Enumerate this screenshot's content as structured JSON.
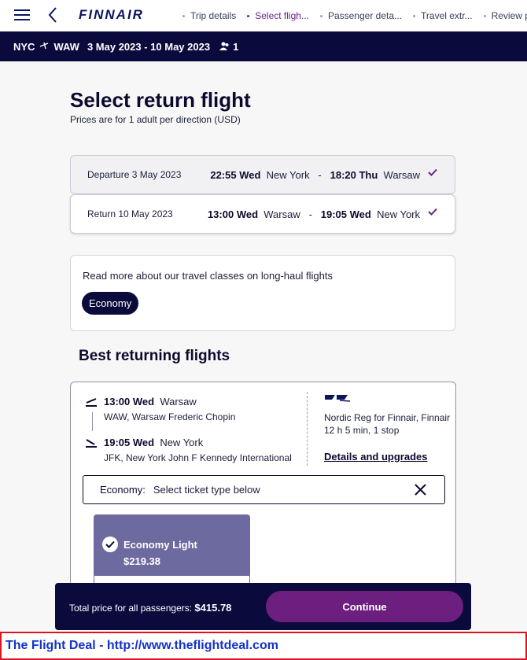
{
  "nav": {
    "logo": "FINNAIR",
    "steps": [
      {
        "label": "Trip details",
        "active": false
      },
      {
        "label": "Select fligh...",
        "active": true
      },
      {
        "label": "Passenger deta...",
        "active": false
      },
      {
        "label": "Travel extr...",
        "active": false
      },
      {
        "label": "Review pu",
        "active": false
      }
    ]
  },
  "trip": {
    "origin": "NYC",
    "destination": "WAW",
    "dates": "3 May 2023 - 10 May 2023",
    "passengers": "1"
  },
  "page": {
    "title": "Select return flight",
    "subtitle": "Prices are for 1 adult per direction (USD)"
  },
  "departure": {
    "label": "Departure 3 May 2023",
    "dep_time": "22:55 Wed",
    "dep_city": "New York",
    "sep": "-",
    "arr_time": "18:20 Thu",
    "arr_city": "Warsaw"
  },
  "return": {
    "label": "Return 10 May 2023",
    "dep_time": "13:00 Wed",
    "dep_city": "Warsaw",
    "sep": "-",
    "arr_time": "19:05 Wed",
    "arr_city": "New York"
  },
  "classes": {
    "text": "Read more about our travel classes on long-haul flights",
    "pill": "Economy"
  },
  "section_title": "Best returning flights",
  "flight": {
    "dep_time": "13:00 Wed",
    "dep_city": "Warsaw",
    "dep_airport": "WAW, Warsaw Frederic Chopin",
    "arr_time": "19:05 Wed",
    "arr_city": "New York",
    "arr_airport": "JFK, New York John F Kennedy International",
    "carrier": "Nordic Reg for Finnair, Finnair",
    "duration": "12 h 5 min, 1 stop",
    "details_link": "Details and upgrades",
    "cabin_label": "Economy:",
    "cabin_hint": "Select ticket type below",
    "fare_name": "Economy Light",
    "fare_price": "$219.38"
  },
  "total": {
    "label": "Total price for all passengers:",
    "amount": "$415.78",
    "continue": "Continue"
  },
  "watermark": "The Flight Deal - http://www.theflightdeal.com",
  "colors": {
    "navy": "#0b0a3d",
    "purple": "#6c1f7e",
    "fare_card": "#6d6a9f",
    "watermark_border": "#e0141e",
    "watermark_text": "#1432c8"
  }
}
